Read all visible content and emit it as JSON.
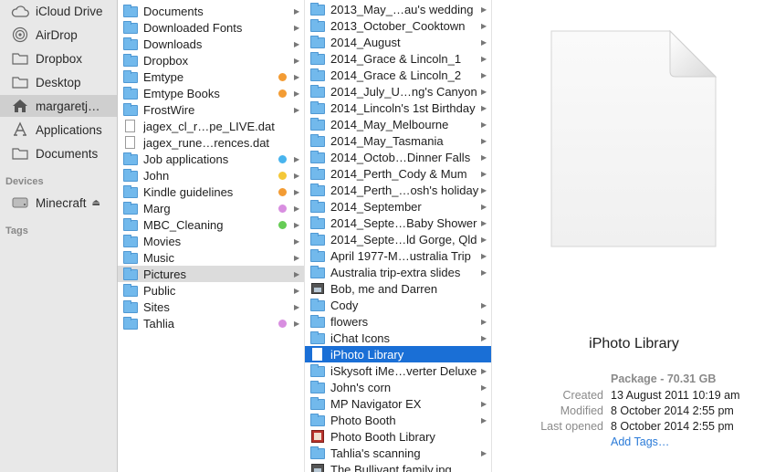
{
  "sidebar": {
    "favorites": [
      {
        "label": "iCloud Drive",
        "icon": "cloud-icon"
      },
      {
        "label": "AirDrop",
        "icon": "airdrop-icon"
      },
      {
        "label": "Dropbox",
        "icon": "folder-icon"
      },
      {
        "label": "Desktop",
        "icon": "folder-icon"
      },
      {
        "label": "margaretj…",
        "icon": "home-icon",
        "active": true
      },
      {
        "label": "Applications",
        "icon": "applications-icon"
      },
      {
        "label": "Documents",
        "icon": "folder-icon"
      }
    ],
    "devices_heading": "Devices",
    "devices": [
      {
        "label": "Minecraft",
        "icon": "disk-icon"
      }
    ],
    "tags_heading": "Tags"
  },
  "column1": [
    {
      "label": "Documents",
      "type": "folder",
      "chevron": true
    },
    {
      "label": "Downloaded Fonts",
      "type": "folder",
      "chevron": true
    },
    {
      "label": "Downloads",
      "type": "folder",
      "chevron": true
    },
    {
      "label": "Dropbox",
      "type": "folder",
      "chevron": true
    },
    {
      "label": "Emtype",
      "type": "folder",
      "chevron": true,
      "tag": "#f39c34"
    },
    {
      "label": "Emtype Books",
      "type": "folder",
      "chevron": true,
      "tag": "#f39c34"
    },
    {
      "label": "FrostWire",
      "type": "folder",
      "chevron": true
    },
    {
      "label": "jagex_cl_r…pe_LIVE.dat",
      "type": "doc"
    },
    {
      "label": "jagex_rune…rences.dat",
      "type": "doc"
    },
    {
      "label": "Job applications",
      "type": "folder",
      "chevron": true,
      "tag": "#48b4ee"
    },
    {
      "label": "John",
      "type": "folder",
      "chevron": true,
      "tag": "#f4c838"
    },
    {
      "label": "Kindle guidelines",
      "type": "folder",
      "chevron": true,
      "tag": "#f39c34"
    },
    {
      "label": "Marg",
      "type": "folder",
      "chevron": true,
      "tag": "#d88ee0"
    },
    {
      "label": "MBC_Cleaning",
      "type": "folder",
      "chevron": true,
      "tag": "#66cc55"
    },
    {
      "label": "Movies",
      "type": "folder",
      "chevron": true
    },
    {
      "label": "Music",
      "type": "folder",
      "chevron": true
    },
    {
      "label": "Pictures",
      "type": "folder",
      "chevron": true,
      "state": "grey"
    },
    {
      "label": "Public",
      "type": "folder",
      "chevron": true
    },
    {
      "label": "Sites",
      "type": "folder",
      "chevron": true
    },
    {
      "label": "Tahlia",
      "type": "folder",
      "chevron": true,
      "tag": "#d88ee0"
    }
  ],
  "column2": [
    {
      "label": "2013_May_…au's wedding",
      "type": "folder",
      "chevron": true
    },
    {
      "label": "2013_October_Cooktown",
      "type": "folder",
      "chevron": true
    },
    {
      "label": "2014_August",
      "type": "folder",
      "chevron": true
    },
    {
      "label": "2014_Grace & Lincoln_1",
      "type": "folder",
      "chevron": true
    },
    {
      "label": "2014_Grace & Lincoln_2",
      "type": "folder",
      "chevron": true
    },
    {
      "label": "2014_July_U…ng's Canyon",
      "type": "folder",
      "chevron": true
    },
    {
      "label": "2014_Lincoln's 1st Birthday",
      "type": "folder",
      "chevron": true
    },
    {
      "label": "2014_May_Melbourne",
      "type": "folder",
      "chevron": true
    },
    {
      "label": "2014_May_Tasmania",
      "type": "folder",
      "chevron": true
    },
    {
      "label": "2014_Octob…Dinner Falls",
      "type": "folder",
      "chevron": true
    },
    {
      "label": "2014_Perth_Cody & Mum",
      "type": "folder",
      "chevron": true
    },
    {
      "label": "2014_Perth_…osh's holiday",
      "type": "folder",
      "chevron": true
    },
    {
      "label": "2014_September",
      "type": "folder",
      "chevron": true
    },
    {
      "label": "2014_Septe…Baby Shower",
      "type": "folder",
      "chevron": true
    },
    {
      "label": "2014_Septe…ld Gorge, Qld",
      "type": "folder",
      "chevron": true
    },
    {
      "label": "April 1977-M…ustralia Trip",
      "type": "folder",
      "chevron": true
    },
    {
      "label": "Australia trip-extra slides",
      "type": "folder",
      "chevron": true
    },
    {
      "label": "Bob, me and Darren",
      "type": "photo"
    },
    {
      "label": "Cody",
      "type": "folder",
      "chevron": true
    },
    {
      "label": "flowers",
      "type": "folder",
      "chevron": true
    },
    {
      "label": "iChat Icons",
      "type": "folder",
      "chevron": true
    },
    {
      "label": "iPhoto Library",
      "type": "doc",
      "state": "sel"
    },
    {
      "label": "iSkysoft iMe…verter Deluxe",
      "type": "folder",
      "chevron": true
    },
    {
      "label": "John's corn",
      "type": "folder",
      "chevron": true
    },
    {
      "label": "MP Navigator EX",
      "type": "folder",
      "chevron": true
    },
    {
      "label": "Photo Booth",
      "type": "folder",
      "chevron": true
    },
    {
      "label": "Photo Booth Library",
      "type": "booth"
    },
    {
      "label": "Tahlia's scanning",
      "type": "folder",
      "chevron": true
    },
    {
      "label": "The Bullivant family.jpg",
      "type": "photo"
    }
  ],
  "preview": {
    "name": "iPhoto Library",
    "kind": "Package - 70.31 GB",
    "created_label": "Created",
    "created_value": "13 August 2011 10:19 am",
    "modified_label": "Modified",
    "modified_value": "8 October 2014 2:55 pm",
    "opened_label": "Last opened",
    "opened_value": "8 October 2014 2:55 pm",
    "add_tags": "Add Tags…"
  },
  "colors": {
    "selection": "#1a6fd6",
    "highlight": "#dcdcdc",
    "folder": "#72b9ec",
    "link": "#2b7bd8"
  }
}
